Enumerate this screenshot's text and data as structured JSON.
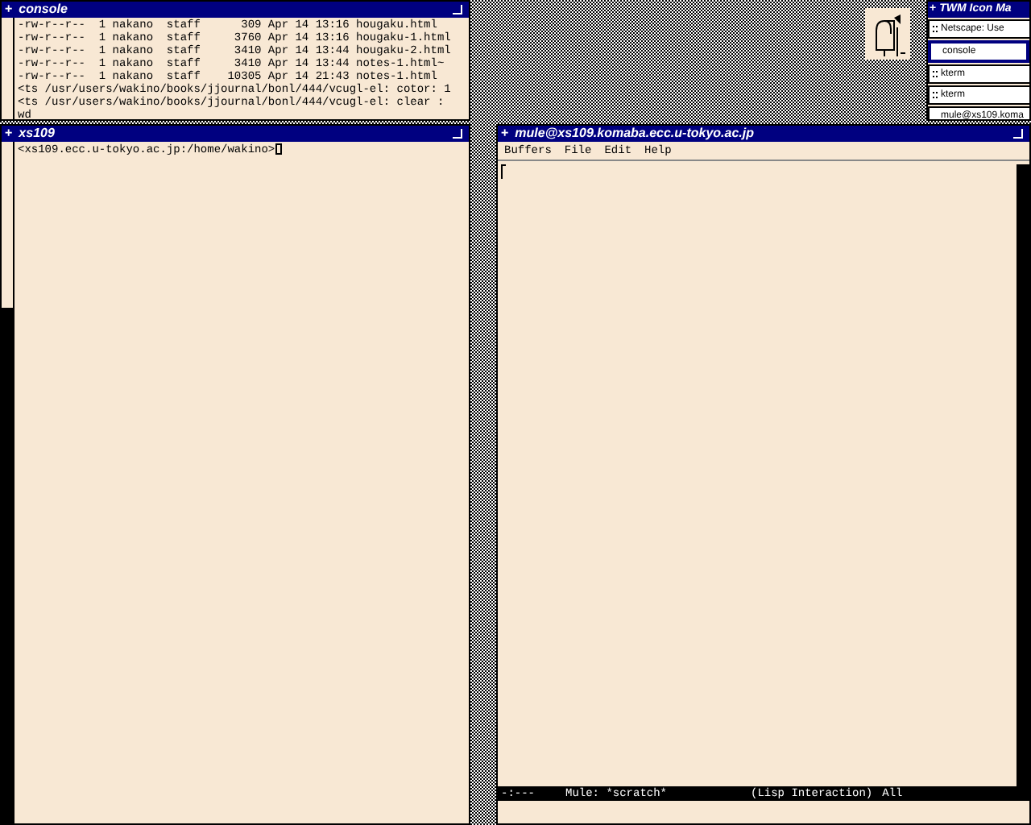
{
  "console": {
    "menu_glyph": "+",
    "title": "console",
    "lines": [
      "-rw-r--r--  1 nakano  staff      309 Apr 14 13:16 hougaku.html",
      "-rw-r--r--  1 nakano  staff     3760 Apr 14 13:16 hougaku-1.html",
      "-rw-r--r--  1 nakano  staff     3410 Apr 14 13:44 hougaku-2.html",
      "-rw-r--r--  1 nakano  staff     3410 Apr 14 13:44 notes-1.html~",
      "-rw-r--r--  1 nakano  staff    10305 Apr 14 21:43 notes-1.html",
      "<ts /usr/users/wakino/books/jjournal/bonl/444/vcugl-el: cotor: 1",
      "<ts /usr/users/wakino/books/jjournal/bonl/444/vcugl-el: clear :",
      "wd"
    ]
  },
  "xterm": {
    "menu_glyph": "+",
    "title": "xs109",
    "prompt": "<xs109.ecc.u-tokyo.ac.jp:/home/wakino>"
  },
  "emacs": {
    "menu_glyph": "+",
    "title": "mule@xs109.komaba.ecc.u-tokyo.ac.jp",
    "menu": [
      "Buffers",
      "File",
      "Edit",
      "Help"
    ],
    "mode_line": [
      "-:---",
      "Mule: *scratch*",
      "(Lisp Interaction)",
      "All"
    ]
  },
  "icon_manager": {
    "menu_glyph": "+",
    "title": "TWM Icon Ma",
    "items": [
      {
        "label": "Netscape: Use",
        "selected": false,
        "iconified": true
      },
      {
        "label": "console",
        "selected": true,
        "iconified": false
      },
      {
        "label": "kterm",
        "selected": false,
        "iconified": true
      },
      {
        "label": "kterm",
        "selected": false,
        "iconified": true
      },
      {
        "label": "mule@xs109.koma",
        "selected": false,
        "iconified": false
      }
    ]
  }
}
